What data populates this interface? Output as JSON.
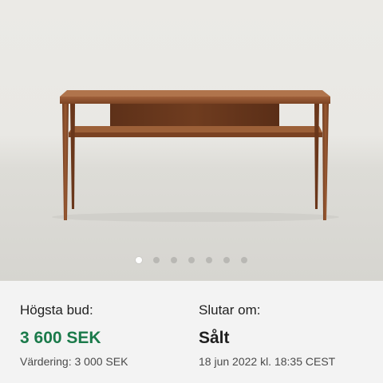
{
  "gallery": {
    "image_subject": "teak console table",
    "dot_count": 7,
    "active_index": 0
  },
  "bid": {
    "label": "Högsta bud:",
    "amount": "3 600 SEK",
    "estimate": "Värdering: 3 000 SEK"
  },
  "ends": {
    "label": "Slutar om:",
    "status": "Sålt",
    "date": "18 jun 2022 kl. 18:35 CEST"
  },
  "colors": {
    "price": "#1a7a4a",
    "panel_bg": "#f3f3f3",
    "wood": "#8a4b26"
  }
}
